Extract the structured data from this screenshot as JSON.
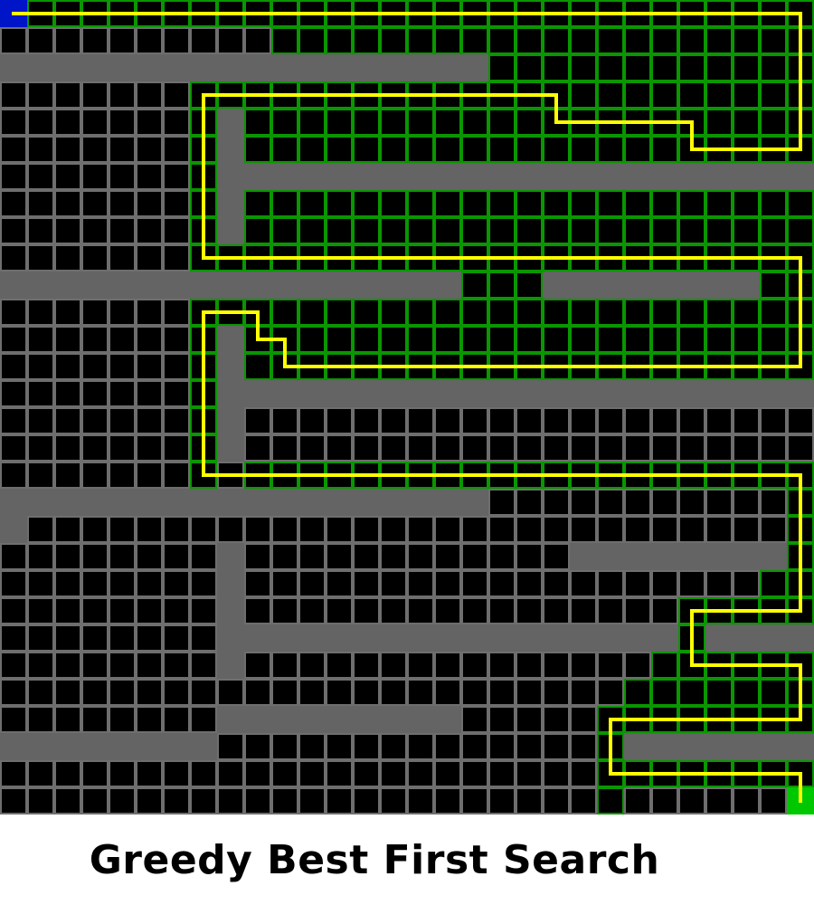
{
  "title": "Greedy Best First Search",
  "grid": {
    "cols": 30,
    "rows": 30,
    "colors": {
      "background": "#000000",
      "gridline": "#6e6e6e",
      "explored_gridline": "#0a9600",
      "wall": "#646464",
      "start": "#0014c8",
      "goal": "#00c800",
      "path": "#ffff00"
    },
    "start": [
      0,
      0
    ],
    "goal": [
      29,
      29
    ],
    "walls": [
      [
        0,
        2,
        18,
        3
      ],
      [
        8,
        4,
        9,
        9
      ],
      [
        9,
        6,
        30,
        7
      ],
      [
        0,
        10,
        17,
        11
      ],
      [
        20,
        10,
        28,
        11
      ],
      [
        8,
        12,
        9,
        17
      ],
      [
        9,
        14,
        30,
        15
      ],
      [
        0,
        18,
        18,
        19
      ],
      [
        0,
        19,
        1,
        20
      ],
      [
        21,
        20,
        29,
        21
      ],
      [
        8,
        20,
        9,
        25
      ],
      [
        9,
        23,
        25,
        24
      ],
      [
        26,
        23,
        30,
        24
      ],
      [
        8,
        26,
        17,
        27
      ],
      [
        0,
        27,
        8,
        28
      ],
      [
        23,
        27,
        30,
        28
      ]
    ],
    "explored_regions": [
      [
        0,
        0,
        30,
        1
      ],
      [
        10,
        1,
        30,
        2
      ],
      [
        18,
        2,
        30,
        3
      ],
      [
        7,
        3,
        30,
        9
      ],
      [
        7,
        9,
        30,
        10
      ],
      [
        17,
        10,
        20,
        11
      ],
      [
        28,
        10,
        30,
        11
      ],
      [
        7,
        11,
        30,
        14
      ],
      [
        7,
        14,
        8,
        18
      ],
      [
        9,
        17,
        30,
        18
      ],
      [
        29,
        18,
        30,
        21
      ],
      [
        28,
        20,
        30,
        22
      ],
      [
        25,
        22,
        30,
        23
      ],
      [
        25,
        23,
        26,
        25
      ],
      [
        24,
        24,
        30,
        25
      ],
      [
        23,
        25,
        30,
        27
      ],
      [
        22,
        26,
        23,
        30
      ],
      [
        22,
        28,
        30,
        29
      ]
    ],
    "path": [
      [
        0,
        0
      ],
      [
        29,
        0
      ],
      [
        29,
        5
      ],
      [
        25,
        5
      ],
      [
        25,
        4
      ],
      [
        20,
        4
      ],
      [
        20,
        3
      ],
      [
        7,
        3
      ],
      [
        7,
        9
      ],
      [
        29,
        9
      ],
      [
        29,
        13
      ],
      [
        10,
        13
      ],
      [
        10,
        12
      ],
      [
        9,
        12
      ],
      [
        9,
        11
      ],
      [
        7,
        11
      ],
      [
        7,
        17
      ],
      [
        29,
        17
      ],
      [
        29,
        22
      ],
      [
        25,
        22
      ],
      [
        25,
        24
      ],
      [
        29,
        24
      ],
      [
        29,
        26
      ],
      [
        22,
        26
      ],
      [
        22,
        28
      ],
      [
        29,
        28
      ],
      [
        29,
        29
      ]
    ]
  }
}
